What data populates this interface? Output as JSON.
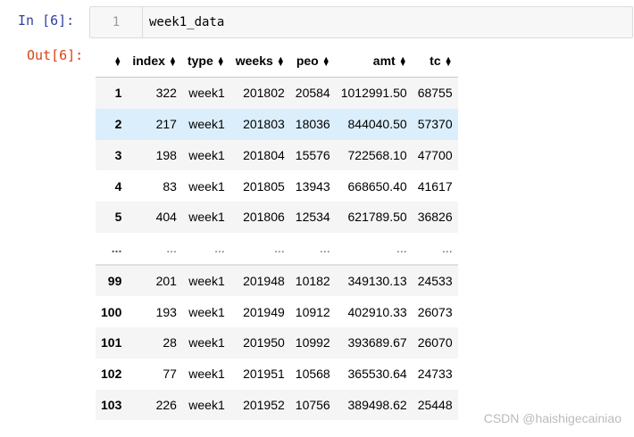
{
  "input_cell": {
    "prompt": "In  [6]:",
    "line_number": "1",
    "code": "week1_data"
  },
  "output_cell": {
    "prompt": "Out[6]:"
  },
  "dataframe": {
    "columns": [
      "index",
      "type",
      "weeks",
      "peo",
      "amt",
      "tc"
    ],
    "rows": [
      {
        "label": "1",
        "cells": [
          "322",
          "week1",
          "201802",
          "20584",
          "1012991.50",
          "68755"
        ]
      },
      {
        "label": "2",
        "cells": [
          "217",
          "week1",
          "201803",
          "18036",
          "844040.50",
          "57370"
        ]
      },
      {
        "label": "3",
        "cells": [
          "198",
          "week1",
          "201804",
          "15576",
          "722568.10",
          "47700"
        ]
      },
      {
        "label": "4",
        "cells": [
          "83",
          "week1",
          "201805",
          "13943",
          "668650.40",
          "41617"
        ]
      },
      {
        "label": "5",
        "cells": [
          "404",
          "week1",
          "201806",
          "12534",
          "621789.50",
          "36826"
        ]
      },
      {
        "label": "...",
        "cells": [
          "...",
          "...",
          "...",
          "...",
          "...",
          "..."
        ]
      },
      {
        "label": "99",
        "cells": [
          "201",
          "week1",
          "201948",
          "10182",
          "349130.13",
          "24533"
        ]
      },
      {
        "label": "100",
        "cells": [
          "193",
          "week1",
          "201949",
          "10912",
          "402910.33",
          "26073"
        ]
      },
      {
        "label": "101",
        "cells": [
          "28",
          "week1",
          "201950",
          "10992",
          "393689.67",
          "26070"
        ]
      },
      {
        "label": "102",
        "cells": [
          "77",
          "week1",
          "201951",
          "10568",
          "365530.64",
          "24733"
        ]
      },
      {
        "label": "103",
        "cells": [
          "226",
          "week1",
          "201952",
          "10756",
          "389498.62",
          "25448"
        ]
      }
    ],
    "hovered_row": "2"
  },
  "watermark": "CSDN @haishigecainiao",
  "colors": {
    "in_prompt": "#303f9f",
    "out_prompt": "#d84315",
    "hover_row": "#dbeefc",
    "stripe_row": "#f5f5f5"
  },
  "icons": {
    "sort": "sort-icon"
  }
}
